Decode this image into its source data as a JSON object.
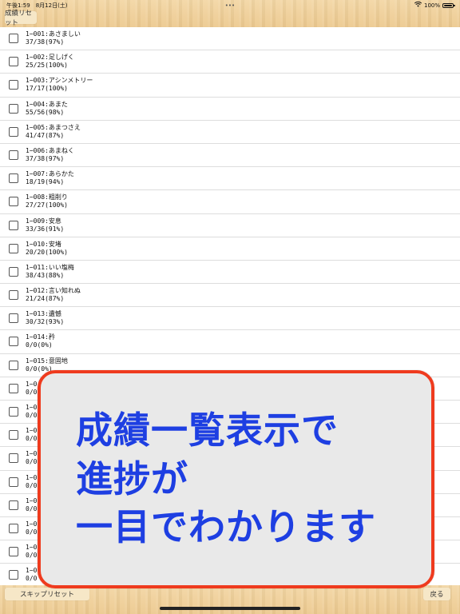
{
  "status_bar": {
    "time": "午後1:59　8月12日(土)",
    "center": "•••",
    "battery": "100%"
  },
  "toolbar": {
    "reset_label": "成績リセット"
  },
  "items": [
    {
      "title": "1−001:あさましい",
      "score": "37/38(97%)"
    },
    {
      "title": "1−002:足しげく",
      "score": "25/25(100%)"
    },
    {
      "title": "1−003:アシンメトリー",
      "score": "17/17(100%)"
    },
    {
      "title": "1−004:あまた",
      "score": "55/56(98%)"
    },
    {
      "title": "1−005:あまつさえ",
      "score": "41/47(87%)"
    },
    {
      "title": "1−006:あまねく",
      "score": "37/38(97%)"
    },
    {
      "title": "1−007:あらかた",
      "score": "18/19(94%)"
    },
    {
      "title": "1−008:粗削り",
      "score": "27/27(100%)"
    },
    {
      "title": "1−009:安息",
      "score": "33/36(91%)"
    },
    {
      "title": "1−010:安堵",
      "score": "20/20(100%)"
    },
    {
      "title": "1−011:いい塩梅",
      "score": "38/43(88%)"
    },
    {
      "title": "1−012:言い知れぬ",
      "score": "21/24(87%)"
    },
    {
      "title": "1−013:遺憾",
      "score": "30/32(93%)"
    },
    {
      "title": "1−014:矜",
      "score": "0/0(0%)"
    },
    {
      "title": "1−015:意固地",
      "score": "0/0(0%)"
    },
    {
      "title": "1−0",
      "score": "0/0"
    },
    {
      "title": "1−0",
      "score": "0/0"
    },
    {
      "title": "1−0",
      "score": "0/0"
    },
    {
      "title": "1−0",
      "score": "0/0"
    },
    {
      "title": "1−0",
      "score": "0/0"
    },
    {
      "title": "1−0",
      "score": "0/0"
    },
    {
      "title": "1−0",
      "score": "0/0"
    },
    {
      "title": "1−0",
      "score": "0/0"
    },
    {
      "title": "1−0",
      "score": "0/0"
    }
  ],
  "bottom": {
    "skip_reset_label": "スキップリセット",
    "back_label": "戻る"
  },
  "callout": {
    "line1": "成績一覧表示で",
    "line2": "進捗が",
    "line3": "一目でわかります"
  },
  "colors": {
    "accent_border": "#ef3b1e",
    "callout_text": "#1e3fe2",
    "wood": "#f0d19a"
  }
}
